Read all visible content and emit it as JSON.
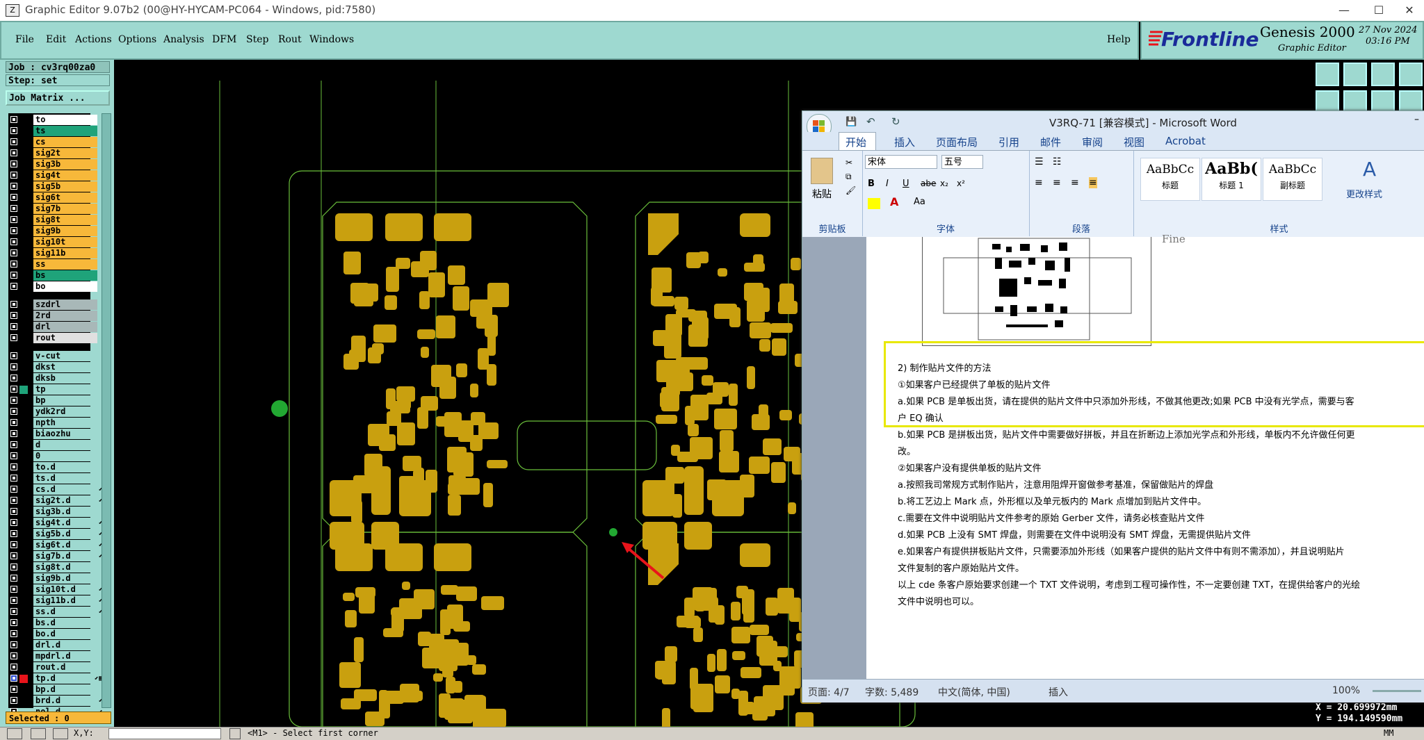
{
  "app": {
    "title": "Graphic Editor 9.07b2 (00@HY-HYCAM-PC064 - Windows, pid:7580)"
  },
  "menu": [
    "File",
    "Edit",
    "Actions",
    "Options",
    "Analysis",
    "DFM",
    "Step",
    "Rout",
    "Windows"
  ],
  "help": "Help",
  "brand": {
    "logo": "Frontline",
    "product": "Genesis 2000",
    "subtitle": "Graphic Editor",
    "date": "27 Nov 2024",
    "time": "03:16 PM"
  },
  "job": {
    "job": "Job : cv3rq00za0",
    "step": "Step: set",
    "matrix": "Job Matrix ..."
  },
  "layers": [
    {
      "name": "to",
      "color": "#ffffff"
    },
    {
      "name": "ts",
      "color": "#1fa37a"
    },
    {
      "name": "cs",
      "color": "#f7b83a"
    },
    {
      "name": "sig2t",
      "color": "#f7b83a"
    },
    {
      "name": "sig3b",
      "color": "#f7b83a"
    },
    {
      "name": "sig4t",
      "color": "#f7b83a"
    },
    {
      "name": "sig5b",
      "color": "#f7b83a"
    },
    {
      "name": "sig6t",
      "color": "#f7b83a"
    },
    {
      "name": "sig7b",
      "color": "#f7b83a"
    },
    {
      "name": "sig8t",
      "color": "#f7b83a"
    },
    {
      "name": "sig9b",
      "color": "#f7b83a"
    },
    {
      "name": "sig10t",
      "color": "#f7b83a"
    },
    {
      "name": "sig11b",
      "color": "#f7b83a"
    },
    {
      "name": "ss",
      "color": "#f7b83a"
    },
    {
      "name": "bs",
      "color": "#1fa37a"
    },
    {
      "name": "bo",
      "color": "#ffffff"
    },
    {
      "name": "",
      "color": ""
    },
    {
      "name": "szdrl",
      "color": "#a8b8b8"
    },
    {
      "name": "2rd",
      "color": "#a8b8b8"
    },
    {
      "name": "drl",
      "color": "#a8b8b8"
    },
    {
      "name": "rout",
      "color": "#e0e0e0"
    },
    {
      "name": "",
      "color": ""
    },
    {
      "name": "v-cut",
      "color": "#9ed9d0"
    },
    {
      "name": "dkst",
      "color": "#9ed9d0"
    },
    {
      "name": "dksb",
      "color": "#9ed9d0"
    },
    {
      "name": "tp",
      "color": "#9ed9d0"
    },
    {
      "name": "bp",
      "color": "#9ed9d0"
    },
    {
      "name": "ydk2rd",
      "color": "#9ed9d0"
    },
    {
      "name": "npth",
      "color": "#9ed9d0"
    },
    {
      "name": "biaozhu",
      "color": "#9ed9d0"
    },
    {
      "name": "d",
      "color": "#9ed9d0"
    },
    {
      "name": "0",
      "color": "#9ed9d0"
    },
    {
      "name": "to.d",
      "color": "#9ed9d0"
    },
    {
      "name": "ts.d",
      "color": "#9ed9d0"
    },
    {
      "name": "cs.d",
      "color": "#9ed9d0",
      "mark": "⬋"
    },
    {
      "name": "sig2t.d",
      "color": "#9ed9d0",
      "mark": "⬋"
    },
    {
      "name": "sig3b.d",
      "color": "#9ed9d0"
    },
    {
      "name": "sig4t.d",
      "color": "#9ed9d0",
      "mark": "⬋"
    },
    {
      "name": "sig5b.d",
      "color": "#9ed9d0",
      "mark": "⬋"
    },
    {
      "name": "sig6t.d",
      "color": "#9ed9d0",
      "mark": "⬋"
    },
    {
      "name": "sig7b.d",
      "color": "#9ed9d0",
      "mark": "⬋"
    },
    {
      "name": "sig8t.d",
      "color": "#9ed9d0"
    },
    {
      "name": "sig9b.d",
      "color": "#9ed9d0"
    },
    {
      "name": "sig10t.d",
      "color": "#9ed9d0",
      "mark": "⬋"
    },
    {
      "name": "sig11b.d",
      "color": "#9ed9d0",
      "mark": "⬋"
    },
    {
      "name": "ss.d",
      "color": "#9ed9d0",
      "mark": "⬋"
    },
    {
      "name": "bs.d",
      "color": "#9ed9d0"
    },
    {
      "name": "bo.d",
      "color": "#9ed9d0"
    },
    {
      "name": "drl.d",
      "color": "#9ed9d0"
    },
    {
      "name": "mpdrl.d",
      "color": "#9ed9d0"
    },
    {
      "name": "rout.d",
      "color": "#9ed9d0"
    },
    {
      "name": "tp.d",
      "color": "#9ed9d0",
      "mark": "⬋▦"
    },
    {
      "name": "bp.d",
      "color": "#9ed9d0"
    },
    {
      "name": "brd.d",
      "color": "#9ed9d0",
      "mark": "⬋"
    },
    {
      "name": "nol.d",
      "color": "#9ed9d0",
      "mark": "⬋"
    }
  ],
  "selected": "Selected : 0",
  "status": {
    "xy": "X,Y:",
    "prompt": "<M1> - Select first corner",
    "mm": "MM"
  },
  "coords": {
    "x": "X = 20.699972mm",
    "y": "Y = 194.149590mm"
  },
  "word": {
    "title": "V3RQ-71 [兼容模式] - Microsoft Word",
    "tabs": [
      "开始",
      "插入",
      "页面布局",
      "引用",
      "邮件",
      "审阅",
      "视图",
      "Acrobat"
    ],
    "groups": [
      "剪贴板",
      "字体",
      "段落",
      "样式"
    ],
    "paste": "粘贴",
    "font": "宋体",
    "size": "五号",
    "styles": [
      {
        "sample": "AaBbCc",
        "name": "标题"
      },
      {
        "sample": "AaBb(",
        "name": "标题 1"
      },
      {
        "sample": "AaBbCc",
        "name": "副标题"
      }
    ],
    "change_styles": "更改样式",
    "doc_fragment": "Fine",
    "lines": [
      "2) 制作贴片文件的方法",
      "①如果客户已经提供了单板的贴片文件",
      "a.如果 PCB 是单板出货，请在提供的贴片文件中只添加外形线，不做其他更改;如果 PCB 中没有光学点，需要与客",
      "户 EQ 确认",
      "b.如果 PCB 是拼板出货，贴片文件中需要做好拼板，并且在折断边上添加光学点和外形线，单板内不允许做任何更",
      "改。",
      "②如果客户没有提供单板的贴片文件",
      "a.按照我司常规方式制作贴片，注意用阻焊开窗做参考基准，保留做贴片的焊盘",
      "b.将工艺边上 Mark 点，外形框以及单元板内的 Mark 点增加到贴片文件中。",
      "c.需要在文件中说明贴片文件参考的原始 Gerber 文件，请务必核查贴片文件",
      "d.如果 PCB 上没有 SMT 焊盘，则需要在文件中说明没有 SMT 焊盘，无需提供贴片文件",
      "e.如果客户有提供拼板贴片文件，只需要添加外形线（如果客户提供的贴片文件中有则不需添加），并且说明贴片",
      "文件复制的客户原始贴片文件。",
      "以上 cde 条客户原始要求创建一个 TXT 文件说明，考虑到工程可操作性，不一定要创建 TXT，在提供给客户的光绘",
      "文件中说明也可以。"
    ],
    "status": {
      "page": "页面: 4/7",
      "words": "字数: 5,489",
      "lang": "中文(简体, 中国)",
      "mode": "插入",
      "zoom": "100%"
    }
  },
  "colors": {
    "pad": "#c9a00f",
    "outline": "#6abf3b",
    "panel": "#9ed9d0",
    "highlight": "#e8e800",
    "arrow": "#e8141b"
  }
}
